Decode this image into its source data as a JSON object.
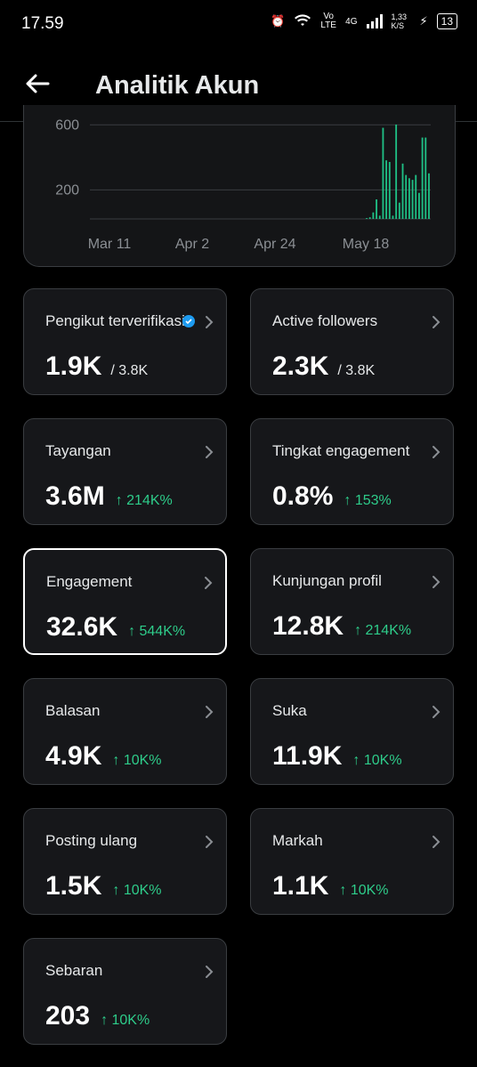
{
  "status_bar": {
    "time": "17.59",
    "network": "4G",
    "speed": "1,33 K/S",
    "battery": "13",
    "volte": "Vo LTE"
  },
  "header": {
    "title": "Analitik Akun"
  },
  "chart_data": {
    "type": "bar",
    "x_tick_labels": [
      "Mar 11",
      "Apr 2",
      "Apr 24",
      "May 18"
    ],
    "y_tick_labels": [
      "600",
      "200"
    ],
    "ylim": [
      0,
      700
    ],
    "grid": true,
    "bar_color": "#1fbf85",
    "values": [
      0,
      0,
      0,
      0,
      0,
      0,
      0,
      0,
      0,
      0,
      0,
      0,
      0,
      0,
      0,
      0,
      0,
      0,
      0,
      0,
      0,
      0,
      0,
      0,
      0,
      0,
      0,
      0,
      0,
      0,
      0,
      0,
      0,
      0,
      0,
      0,
      0,
      0,
      0,
      0,
      0,
      0,
      0,
      0,
      0,
      0,
      0,
      0,
      0,
      0,
      0,
      0,
      0,
      0,
      0,
      0,
      0,
      0,
      0,
      0,
      0,
      0,
      0,
      0,
      0,
      0,
      0,
      0,
      0,
      0,
      0,
      0,
      0,
      0,
      0,
      0,
      0,
      0,
      0,
      0,
      0,
      0,
      0,
      0,
      5,
      10,
      40,
      120,
      20,
      560,
      360,
      350,
      20,
      580,
      100,
      340,
      270,
      250,
      240,
      270,
      160,
      500,
      500,
      280
    ]
  },
  "cards": [
    {
      "label": "Pengikut terverifikasi",
      "value": "1.9K",
      "sub": "/ 3.8K",
      "delta": "",
      "verified": true
    },
    {
      "label": "Active followers",
      "value": "2.3K",
      "sub": "/ 3.8K",
      "delta": ""
    },
    {
      "label": "Tayangan",
      "value": "3.6M",
      "sub": "",
      "delta": "↑ 214K%"
    },
    {
      "label": "Tingkat engagement",
      "value": "0.8%",
      "sub": "",
      "delta": "↑ 153%"
    },
    {
      "label": "Engagement",
      "value": "32.6K",
      "sub": "",
      "delta": "↑ 544K%",
      "selected": true
    },
    {
      "label": "Kunjungan profil",
      "value": "12.8K",
      "sub": "",
      "delta": "↑ 214K%"
    },
    {
      "label": "Balasan",
      "value": "4.9K",
      "sub": "",
      "delta": "↑ 10K%"
    },
    {
      "label": "Suka",
      "value": "11.9K",
      "sub": "",
      "delta": "↑ 10K%"
    },
    {
      "label": "Posting ulang",
      "value": "1.5K",
      "sub": "",
      "delta": "↑ 10K%"
    },
    {
      "label": "Markah",
      "value": "1.1K",
      "sub": "",
      "delta": "↑ 10K%"
    },
    {
      "label": "Sebaran",
      "value": "203",
      "sub": "",
      "delta": "↑ 10K%"
    }
  ],
  "colors": {
    "accent_green": "#2ecc8a",
    "verified_blue": "#1d9bf0",
    "card_bg": "#16171a"
  }
}
